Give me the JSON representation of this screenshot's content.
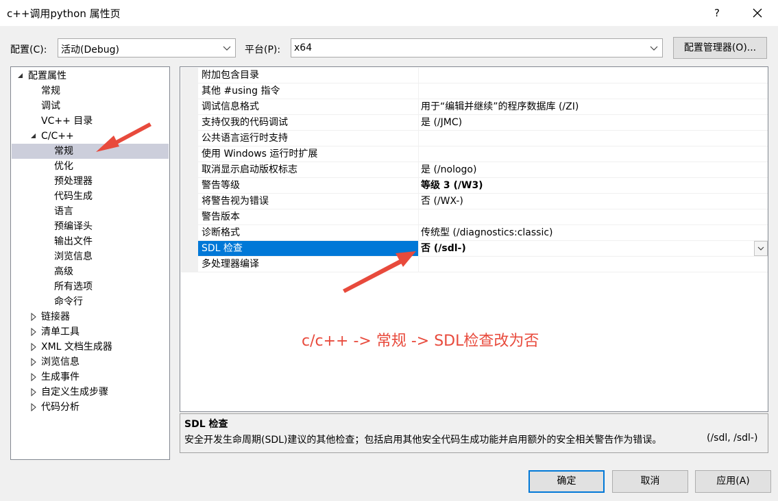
{
  "window": {
    "title": "c++调用python 属性页",
    "help_label": "?",
    "close_label": "✕"
  },
  "config_row": {
    "configuration_label": "配置(C):",
    "configuration_value": "活动(Debug)",
    "platform_label": "平台(P):",
    "platform_value": "x64",
    "manager_button": "配置管理器(O)..."
  },
  "tree": {
    "items": [
      {
        "label": "配置属性",
        "expander": "expanded"
      },
      {
        "label": "常规"
      },
      {
        "label": "调试"
      },
      {
        "label": "VC++ 目录"
      },
      {
        "label": "C/C++",
        "expander": "expanded"
      },
      {
        "label": "常规",
        "selected": true
      },
      {
        "label": "优化"
      },
      {
        "label": "预处理器"
      },
      {
        "label": "代码生成"
      },
      {
        "label": "语言"
      },
      {
        "label": "预编译头"
      },
      {
        "label": "输出文件"
      },
      {
        "label": "浏览信息"
      },
      {
        "label": "高级"
      },
      {
        "label": "所有选项"
      },
      {
        "label": "命令行"
      },
      {
        "label": "链接器",
        "expander": "collapsed"
      },
      {
        "label": "清单工具",
        "expander": "collapsed"
      },
      {
        "label": "XML 文档生成器",
        "expander": "collapsed"
      },
      {
        "label": "浏览信息",
        "expander": "collapsed"
      },
      {
        "label": "生成事件",
        "expander": "collapsed"
      },
      {
        "label": "自定义生成步骤",
        "expander": "collapsed"
      },
      {
        "label": "代码分析",
        "expander": "collapsed"
      }
    ]
  },
  "grid": {
    "rows": [
      {
        "name": "附加包含目录",
        "value": ""
      },
      {
        "name": "其他 #using 指令",
        "value": ""
      },
      {
        "name": "调试信息格式",
        "value": "用于“编辑并继续”的程序数据库 (/ZI)"
      },
      {
        "name": "支持仅我的代码调试",
        "value": "是 (/JMC)"
      },
      {
        "name": "公共语言运行时支持",
        "value": ""
      },
      {
        "name": "使用 Windows 运行时扩展",
        "value": ""
      },
      {
        "name": "取消显示启动版权标志",
        "value": "是 (/nologo)"
      },
      {
        "name": "警告等级",
        "value": "等级 3 (/W3)",
        "bold": true
      },
      {
        "name": "将警告视为错误",
        "value": "否 (/WX-)"
      },
      {
        "name": "警告版本",
        "value": ""
      },
      {
        "name": "诊断格式",
        "value": "传统型 (/diagnostics:classic)"
      },
      {
        "name": "SDL 检查",
        "value": "否 (/sdl-)",
        "bold": true,
        "selected": true
      },
      {
        "name": "多处理器编译",
        "value": ""
      }
    ]
  },
  "description": {
    "title": "SDL 检查",
    "text": "安全开发生命周期(SDL)建议的其他检查；包括启用其他安全代码生成功能并启用额外的安全相关警告作为错误。",
    "switches": "(/sdl, /sdl-)"
  },
  "buttons": {
    "ok": "确定",
    "cancel": "取消",
    "apply": "应用(A)"
  },
  "annotation": {
    "text": "c/c++ -> 常规 -> SDL检查改为否",
    "color": "#e84a3c"
  },
  "colors": {
    "selection": "#0078d7",
    "tree_selection": "#cccedb"
  }
}
